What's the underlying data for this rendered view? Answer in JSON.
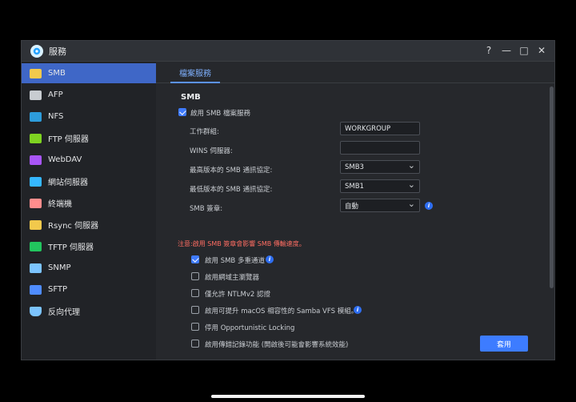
{
  "window": {
    "title": "服務",
    "controls": [
      "?",
      "—",
      "□",
      "✕"
    ]
  },
  "sidebar": {
    "items": [
      {
        "label": "SMB",
        "icon": "folder-icon",
        "color": "#f2c94c",
        "active": true
      },
      {
        "label": "AFP",
        "icon": "afp-icon",
        "color": "#c8ccd1",
        "active": false
      },
      {
        "label": "NFS",
        "icon": "nfs-icon",
        "color": "#2d9cdb",
        "active": false
      },
      {
        "label": "FTP 伺服器",
        "icon": "ftp-icon",
        "color": "#7ed321",
        "active": false
      },
      {
        "label": "WebDAV",
        "icon": "webdav-icon",
        "color": "#a855f7",
        "active": false
      },
      {
        "label": "網站伺服器",
        "icon": "web-server-icon",
        "color": "#35b7ff",
        "active": false
      },
      {
        "label": "終端機",
        "icon": "terminal-icon",
        "color": "#ff8d8d",
        "active": false
      },
      {
        "label": "Rsync 伺服器",
        "icon": "rsync-icon",
        "color": "#f2c94c",
        "active": false
      },
      {
        "label": "TFTP 伺服器",
        "icon": "tftp-icon",
        "color": "#22c55e",
        "active": false
      },
      {
        "label": "SNMP",
        "icon": "snmp-icon",
        "color": "#7cc4ff",
        "active": false
      },
      {
        "label": "SFTP",
        "icon": "sftp-icon",
        "color": "#4f8cff",
        "active": false
      },
      {
        "label": "反向代理",
        "icon": "shield-icon",
        "color": "#7cc4ff",
        "active": false
      }
    ]
  },
  "main": {
    "tab": "檔案服務",
    "section_title": "SMB",
    "enable_smb": {
      "label": "啟用 SMB 檔案服務",
      "checked": true
    },
    "fields": [
      {
        "label": "工作群組:",
        "value": "WORKGROUP",
        "type": "input"
      },
      {
        "label": "WINS 伺服器:",
        "value": "",
        "type": "input"
      },
      {
        "label": "最高版本的 SMB 通訊協定:",
        "value": "SMB3",
        "type": "select"
      },
      {
        "label": "最低版本的 SMB 通訊協定:",
        "value": "SMB1",
        "type": "select"
      },
      {
        "label": "SMB 簽章:",
        "value": "自動",
        "type": "select",
        "info": true
      }
    ],
    "notice": "注意:啟用 SMB 簽章會影響 SMB 傳輸速度。",
    "options": [
      {
        "label": "啟用 SMB 多重通道",
        "checked": true,
        "info": true
      },
      {
        "label": "啟用網域主瀏覽器",
        "checked": false,
        "info": false
      },
      {
        "label": "僅允許 NTLMv2 認證",
        "checked": false,
        "info": false
      },
      {
        "label": "啟用可提升 macOS 相容性的 Samba VFS 模組。",
        "checked": false,
        "info": true
      },
      {
        "label": "停用 Opportunistic Locking",
        "checked": false,
        "info": false
      },
      {
        "label": "啟用傳錯記錄功能 (開啟後可能會影響系統效能)",
        "checked": false,
        "info": false
      }
    ],
    "apply_button": "套用"
  }
}
